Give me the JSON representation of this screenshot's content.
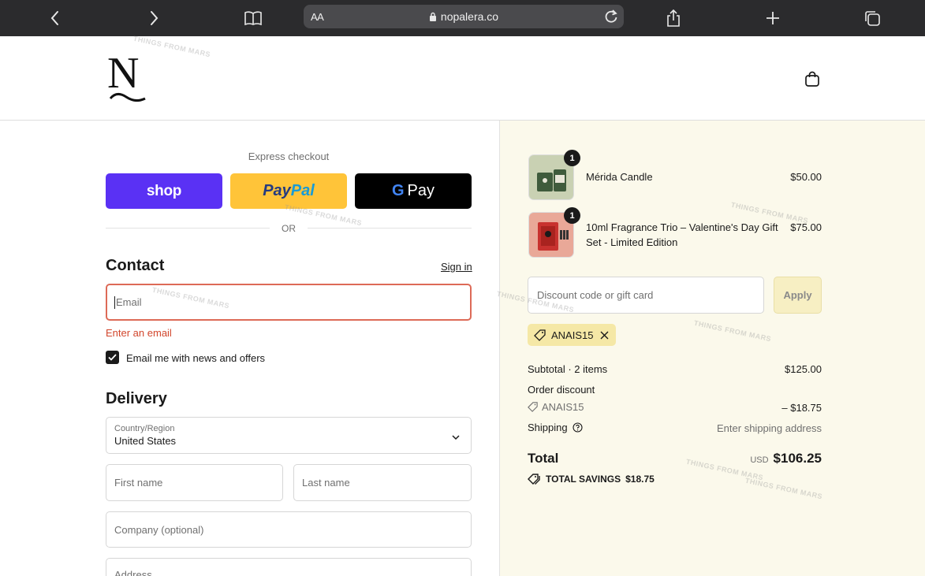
{
  "browser": {
    "aa_label": "AA",
    "url": "nopalera.co"
  },
  "header": {
    "logo_letter": "N"
  },
  "express": {
    "label": "Express checkout",
    "shop_label": "shop",
    "paypal_part1": "Pay",
    "paypal_part2": "Pal",
    "gpay_g": "G",
    "gpay_label": "Pay",
    "or_label": "OR"
  },
  "contact": {
    "heading": "Contact",
    "sign_in": "Sign in",
    "email_placeholder": "Email",
    "error": "Enter an email",
    "newsletter_label": "Email me with news and offers",
    "newsletter_checked": true
  },
  "delivery": {
    "heading": "Delivery",
    "country_label": "Country/Region",
    "country_value": "United States",
    "first_name_placeholder": "First name",
    "last_name_placeholder": "Last name",
    "company_placeholder": "Company (optional)",
    "address_placeholder": "Address"
  },
  "order": {
    "items": [
      {
        "name": "Mérida Candle",
        "price": "$50.00",
        "qty": "1"
      },
      {
        "name": "10ml Fragrance Trio – Valentine's Day Gift Set - Limited Edition",
        "price": "$75.00",
        "qty": "1"
      }
    ],
    "discount_placeholder": "Discount code or gift card",
    "apply_label": "Apply",
    "applied_code": "ANAIS15",
    "subtotal_label": "Subtotal · 2 items",
    "subtotal_value": "$125.00",
    "order_discount_label": "Order discount",
    "discount_code": "ANAIS15",
    "discount_value": "– $18.75",
    "shipping_label": "Shipping",
    "shipping_value": "Enter shipping address",
    "total_label": "Total",
    "total_currency": "USD",
    "total_value": "$106.25",
    "savings_label": "TOTAL SAVINGS",
    "savings_value": "$18.75"
  },
  "watermark": "THINGS FROM MARS",
  "colors": {
    "shop_purple": "#5a31f4",
    "paypal_yellow": "#ffc439",
    "error_red": "#d2462c",
    "summary_bg": "#fbf9eb",
    "tag_bg": "#f5e8a6"
  }
}
